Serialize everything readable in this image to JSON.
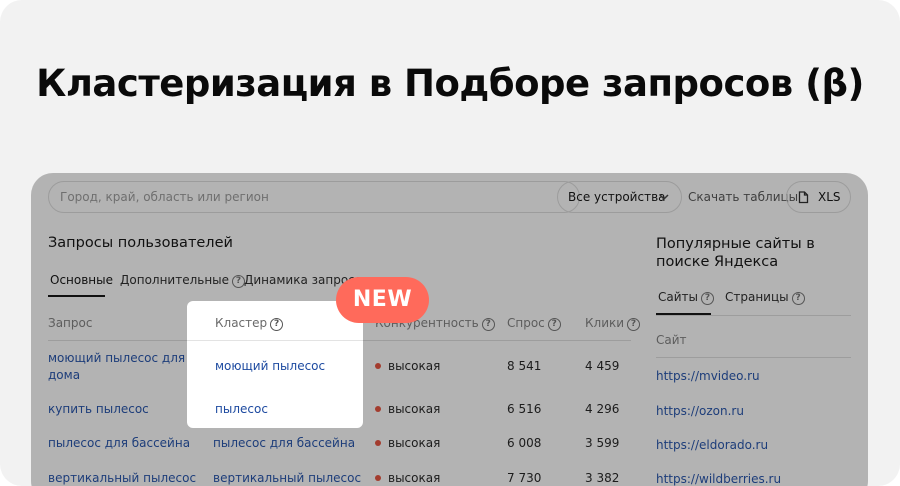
{
  "hero": {
    "title": "Кластеризация в Подборе запросов (β)"
  },
  "toolbar": {
    "region_placeholder": "Город, край, область или регион",
    "device_select": "Все устройства",
    "download_label": "Скачать таблицы",
    "xls_label": "XLS"
  },
  "left": {
    "title": "Запросы пользователей",
    "tabs": [
      {
        "label": "Основные"
      },
      {
        "label": "Дополнительные"
      },
      {
        "label": "Динамика запросов"
      }
    ],
    "columns": {
      "query": "Запрос",
      "cluster": "Кластер",
      "competition": "Конкурентность",
      "demand": "Спрос",
      "clicks": "Клики"
    },
    "rows": [
      {
        "query": "моющий пылесос для дома",
        "cluster": "моющий пылесос",
        "competition": "высокая",
        "demand": "8 541",
        "clicks": "4 459"
      },
      {
        "query": "купить пылесос",
        "cluster": "пылесос",
        "competition": "высокая",
        "demand": "6 516",
        "clicks": "4 296"
      },
      {
        "query": "пылесос для бассейна",
        "cluster": "пылесос для бассейна",
        "competition": "высокая",
        "demand": "6 008",
        "clicks": "3 599"
      },
      {
        "query": "вертикальный пылесос",
        "cluster": "вертикальный пылесос",
        "competition": "высокая",
        "demand": "7 730",
        "clicks": "3 382"
      }
    ]
  },
  "badge": {
    "label": "NEW"
  },
  "right": {
    "title": "Популярные сайты в поиске Яндекса",
    "tabs": [
      {
        "label": "Сайты"
      },
      {
        "label": "Страницы"
      }
    ],
    "column": "Сайт",
    "sites": [
      "https://mvideo.ru",
      "https://ozon.ru",
      "https://eldorado.ru",
      "https://wildberries.ru"
    ]
  },
  "colors": {
    "badge": "#ff6a5b",
    "link": "#1d3d7a",
    "competition_dot": "#a33c2e",
    "overlay": "#b3b3b3"
  }
}
